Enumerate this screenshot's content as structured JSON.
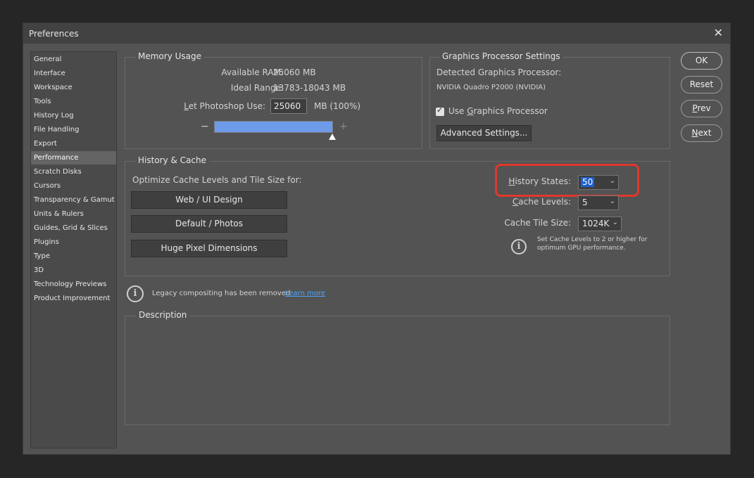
{
  "window": {
    "title": "Preferences",
    "close_glyph": "✕"
  },
  "sidebar": {
    "items": [
      "General",
      "Interface",
      "Workspace",
      "Tools",
      "History Log",
      "File Handling",
      "Export",
      "Performance",
      "Scratch Disks",
      "Cursors",
      "Transparency & Gamut",
      "Units & Rulers",
      "Guides, Grid & Slices",
      "Plugins",
      "Type",
      "3D",
      "Technology Previews",
      "Product Improvement"
    ],
    "selected": "Performance"
  },
  "memory": {
    "legend": "Memory Usage",
    "available_label": "Available RAM:",
    "available_value": "25060 MB",
    "ideal_label": "Ideal Range:",
    "ideal_value": "13783-18043 MB",
    "let_label_pre": "L",
    "let_label_post": "et Photoshop Use:",
    "let_value": "25060",
    "let_unit": "MB (100%)",
    "minus": "−",
    "plus": "+",
    "slider_fraction": 1.0
  },
  "gpu": {
    "legend": "Graphics Processor Settings",
    "detected_label": "Detected Graphics Processor:",
    "detected_value": "NVIDIA Quadro P2000 (NVIDIA)",
    "use_label_pre": "Use ",
    "use_label_u": "G",
    "use_label_post": "raphics Processor",
    "use_checked": true,
    "advanced_button": "Advanced Settings..."
  },
  "history_cache": {
    "legend": "History & Cache",
    "optimize_label": "Optimize Cache Levels and Tile Size for:",
    "buttons": [
      "Web / UI Design",
      "Default / Photos",
      "Huge Pixel Dimensions"
    ],
    "history_states_u": "H",
    "history_states_rest": "istory States:",
    "history_states_value": "50",
    "cache_levels_u": "C",
    "cache_levels_rest": "ache Levels:",
    "cache_levels_value": "5",
    "tile_size_label": "Cache Tile Size:",
    "tile_size_value": "1024K",
    "info_text_1": "Set Cache Levels to 2 or higher for",
    "info_text_2": "optimum GPU performance."
  },
  "legacy": {
    "text": "Legacy compositing has been removed",
    "link": "Learn more"
  },
  "description": {
    "legend": "Description"
  },
  "buttons": {
    "ok": "OK",
    "reset": "Reset",
    "prev_u": "P",
    "prev_rest": "rev",
    "next_u": "N",
    "next_rest": "ext"
  },
  "colors": {
    "highlight_box": "#e0382c",
    "slider_fill": "#6d9bea",
    "link": "#4fa3ff",
    "selection": "#1d5fcf"
  }
}
